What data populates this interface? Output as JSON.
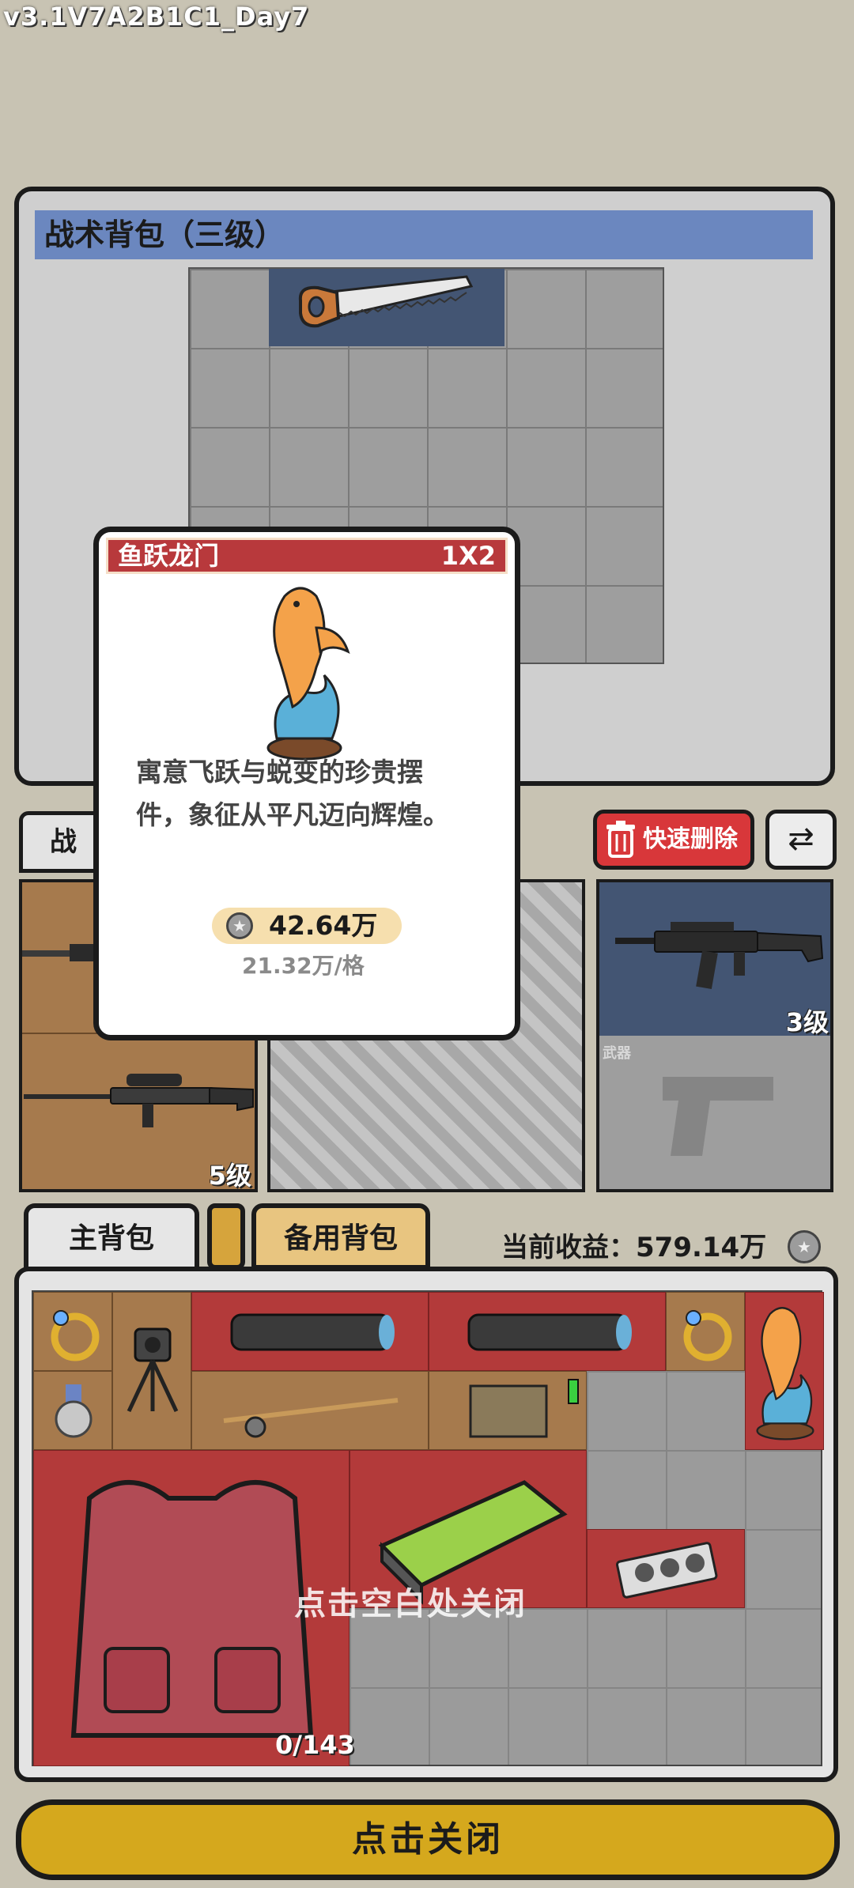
{
  "version": "v3.1V7A2B1C1_Day7",
  "tactical_backpack": {
    "title": "战术背包（三级）"
  },
  "popup": {
    "name": "鱼跃龙门",
    "size": "1X2",
    "description_line1": "寓意飞跃与蜕变的珍贵摆",
    "description_line2": "件，象征从平凡迈向辉煌。",
    "price": "42.64万",
    "price_per_cell": "21.32万/格"
  },
  "equipment": {
    "tab_label": "战备",
    "quick_delete_label": "快速删除",
    "left_slot_level": "5级",
    "right_slot_level": "3级",
    "weapon_label": "武器"
  },
  "inventory": {
    "main_tab": "主背包",
    "spare_tab": "备用背包",
    "earnings_label": "当前收益：579.14万",
    "capacity": "0/143",
    "close_hint": "点击空白处关闭"
  },
  "close_button": "点击关闭",
  "colors": {
    "background": "#c8c3b3",
    "title_bar": "#6b87bf",
    "popup_header": "#b8393c",
    "delete_button": "#d8373a",
    "close_button": "#d5a81d",
    "item_brown": "#a67a4d",
    "item_red": "#b33a3a"
  }
}
